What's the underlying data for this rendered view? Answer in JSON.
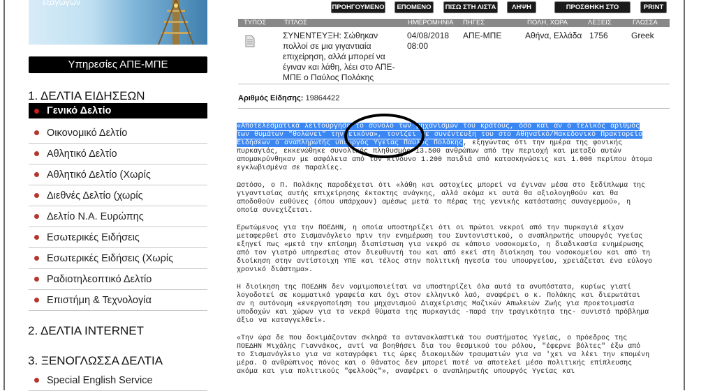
{
  "banner": {
    "text": "εξαγωγών"
  },
  "sidebar": {
    "services_title": "Υπηρεσίες ΑΠΕ-ΜΠΕ",
    "section1_title": "1. ΔΕΛΤΙΑ ΕΙΔΗΣΕΩΝ",
    "section1_items": [
      {
        "label": "Γενικό Δελτίο",
        "active": true
      },
      {
        "label": "Οικονομικό Δελτίο"
      },
      {
        "label": "Αθλητικό Δελτίο"
      },
      {
        "label": "Αθλητικό Δελτίο (Χωρίς"
      },
      {
        "label": "Διεθνές Δελτίο (χωρίς"
      },
      {
        "label": "Δελτίο Ν.Α. Ευρώπης"
      },
      {
        "label": "Εσωτερικές Ειδήσεις"
      },
      {
        "label": "Εσωτερικές Ειδήσεις (Χωρίς"
      },
      {
        "label": "Ραδιοτηλεοπτικό Δελτίο"
      },
      {
        "label": "Επιστήμη & Τεχνολογία"
      }
    ],
    "section2_title": "2. ΔΕΛΤΙΑ INTERNET",
    "section3_title": "3. ΞΕΝΟΓΛΩΣΣΑ ΔΕΛΤΙΑ",
    "section3_items": [
      {
        "label": "Special English Service"
      }
    ]
  },
  "toolbar": {
    "previous": "ΠΡΟΗΓΟΥΜΕΝΟ",
    "next": "ΕΠΟΜΕΝΟ",
    "back_to_list": "ΠΙΣΩ ΣΤΗ ΛΙΣΤΑ",
    "download": "ΛΗΨΗ",
    "add_to_cart": "ΠΡΟΣΘΗΚΗ ΣΤΟ ΚΑΛΑΘΙ",
    "print": "PRINT"
  },
  "results": {
    "headers": {
      "type": "ΤΥΠΟΣ",
      "title": "ΤΙΤΛΟΣ",
      "date": "ΗΜΕΡΟΜΗΝΙΑ",
      "source": "ΠΗΓΕΣ",
      "place": "ΠΟΛΗ, ΧΩΡΑ",
      "words": "ΛΕΞΕΙΣ",
      "language": "ΓΛΩΣΣΑ"
    },
    "row": {
      "title_lines": [
        "ΣΥΝΕΝΤΕΥΞΗ: Σώθηκαν",
        "πολλοί σε μια γιγαντιαία",
        "επιχείρηση, αλλά μπορεί να",
        "έγιναν και λάθη, λέει στο ΑΠΕ-",
        "ΜΠΕ ο Παύλος Πολάκης"
      ],
      "date_line1": "04/08/2018",
      "date_line2": "08:00",
      "source": "ΑΠΕ-ΜΠΕ",
      "place": "Αθήνα, Ελλάδα",
      "words": "1756",
      "language": "Greek"
    }
  },
  "news_id": {
    "label": "Αριθμός Είδησης:",
    "value": "19864422"
  },
  "article": {
    "p1_highlight": "«Αποτελεσματικά λειτούργησε το σύνολο των μηχανισμών του κράτους, όσο και αν ο τελικός αριθμός των θυμάτων \"θολώνει\" την εικόνα», τονίζει σε συνέντευξη του στο Αθηναϊκό/Μακεδονικό Πρακτορείο Ειδήσεων ο αναπληρωτής υπουργός Υγείας Παύλος Πολάκης",
    "p1_rest": ", εξηγώντας ότι την ημέρα της φονικής πυρκαγιάς, εκκενώθηκε συνολικός πληθυσμός 13.500 ανθρώπων από την περιοχή και μεταξύ αυτών απομακρύνθηκαν με ασφάλεια από τον κίνδυνο 1.200 παιδιά από κατασκηνώσεις και 1.000 περίπου άτομα εγκλωβισμένα σε παραλίες.",
    "p2": "Ωστόσο, ο Π. Πολάκης παραδέχεται ότι «λάθη και αστοχίες μπορεί να έγιναν μέσα στο ξεδίπλωμα της γιγαντιαίας αυτής επιχείρησης έκτακτης ανάγκης, αλλά ακόμα κι αυτά θα αξιολογηθούν και θα αποδοθούν ευθύνες (όπου υπάρχουν) αμέσως μετά το πέρας της γενικής κατάστασης συναγερμού», η οποία συνεχίζεται.",
    "p3": "Ερωτώμενος για την ΠΟΕΔΗΝ, η οποία υποστηρίζει ότι οι πρώτοι νεκροί από την πυρκαγιά είχαν μεταφερθεί στο Σισμανόγλειο πριν την ενημέρωση του Συντονιστικού, ο αναπληρωτής υπουργός Υγείας εξηγεί πως «μετά την επίσημη διαπίστωση για νεκρό σε κάποιο νοσοκομείο, η διαδικασία ενημέρωσης από τον γιατρό υπηρεσίας στον διευθυντή του και από εκεί στη διοίκηση του νοσοκομείου και από τη διοίκηση στην αντίστοιχη ΥΠΕ και τέλος στην πολιτική ηγεσία του υπουργείου, χρειάζεται ένα εύλογο χρονικό διάστημα».",
    "p4": "Η διοίκηση της ΠΟΕΔΗΝ δεν νομιμοποιείται να υποστηρίζει όλα αυτά τα ανυπόστατα, κυρίως γιατί λογοδοτεί σε κομματικά γραφεία και όχι στον ελληνικό λαό, αναφέρει ο κ. Πολάκης και διερωτάται αν η αυτόνομη «ενεργοποίηση του μηχανισμού Διαχείρισης Μαζικών Απωλειών Ζωής για προετοιμασία υποδοχών και χώρων για τα νεκρά θύματα της πυρκαγιάς -παρά την τραγικότητα της- συνιστά πρόβλημα άξιο να καταγγελθεί».",
    "p5": "«Την ώρα δε που δοκιμάζονταν σκληρά τα αντανακλαστικά του συστήματος Υγείας, ο πρόεδρος της ΠΟΕΔΗΝ Μιχάλης Γιαννάκος, αντί να βοηθήσει δια του θεσμικού του ρόλου, \"έφερνε βόλτες\" έξω από το Σισμανόγλειο για να καταγράφει τις ώρες διακομιδών τραυματιών για να 'χει να λέει την επομένη μέρα. Ο ανθρώπινος πόνος και ο θάνατος δεν μπορεί ποτέ να αποτελεί μέσο πολιτικής επίπλευσης ακόμα και για πολιτικούς \"φελλούς\"», αναφέρει ο αναπληρωτής υπουργός Υγείας και"
  }
}
